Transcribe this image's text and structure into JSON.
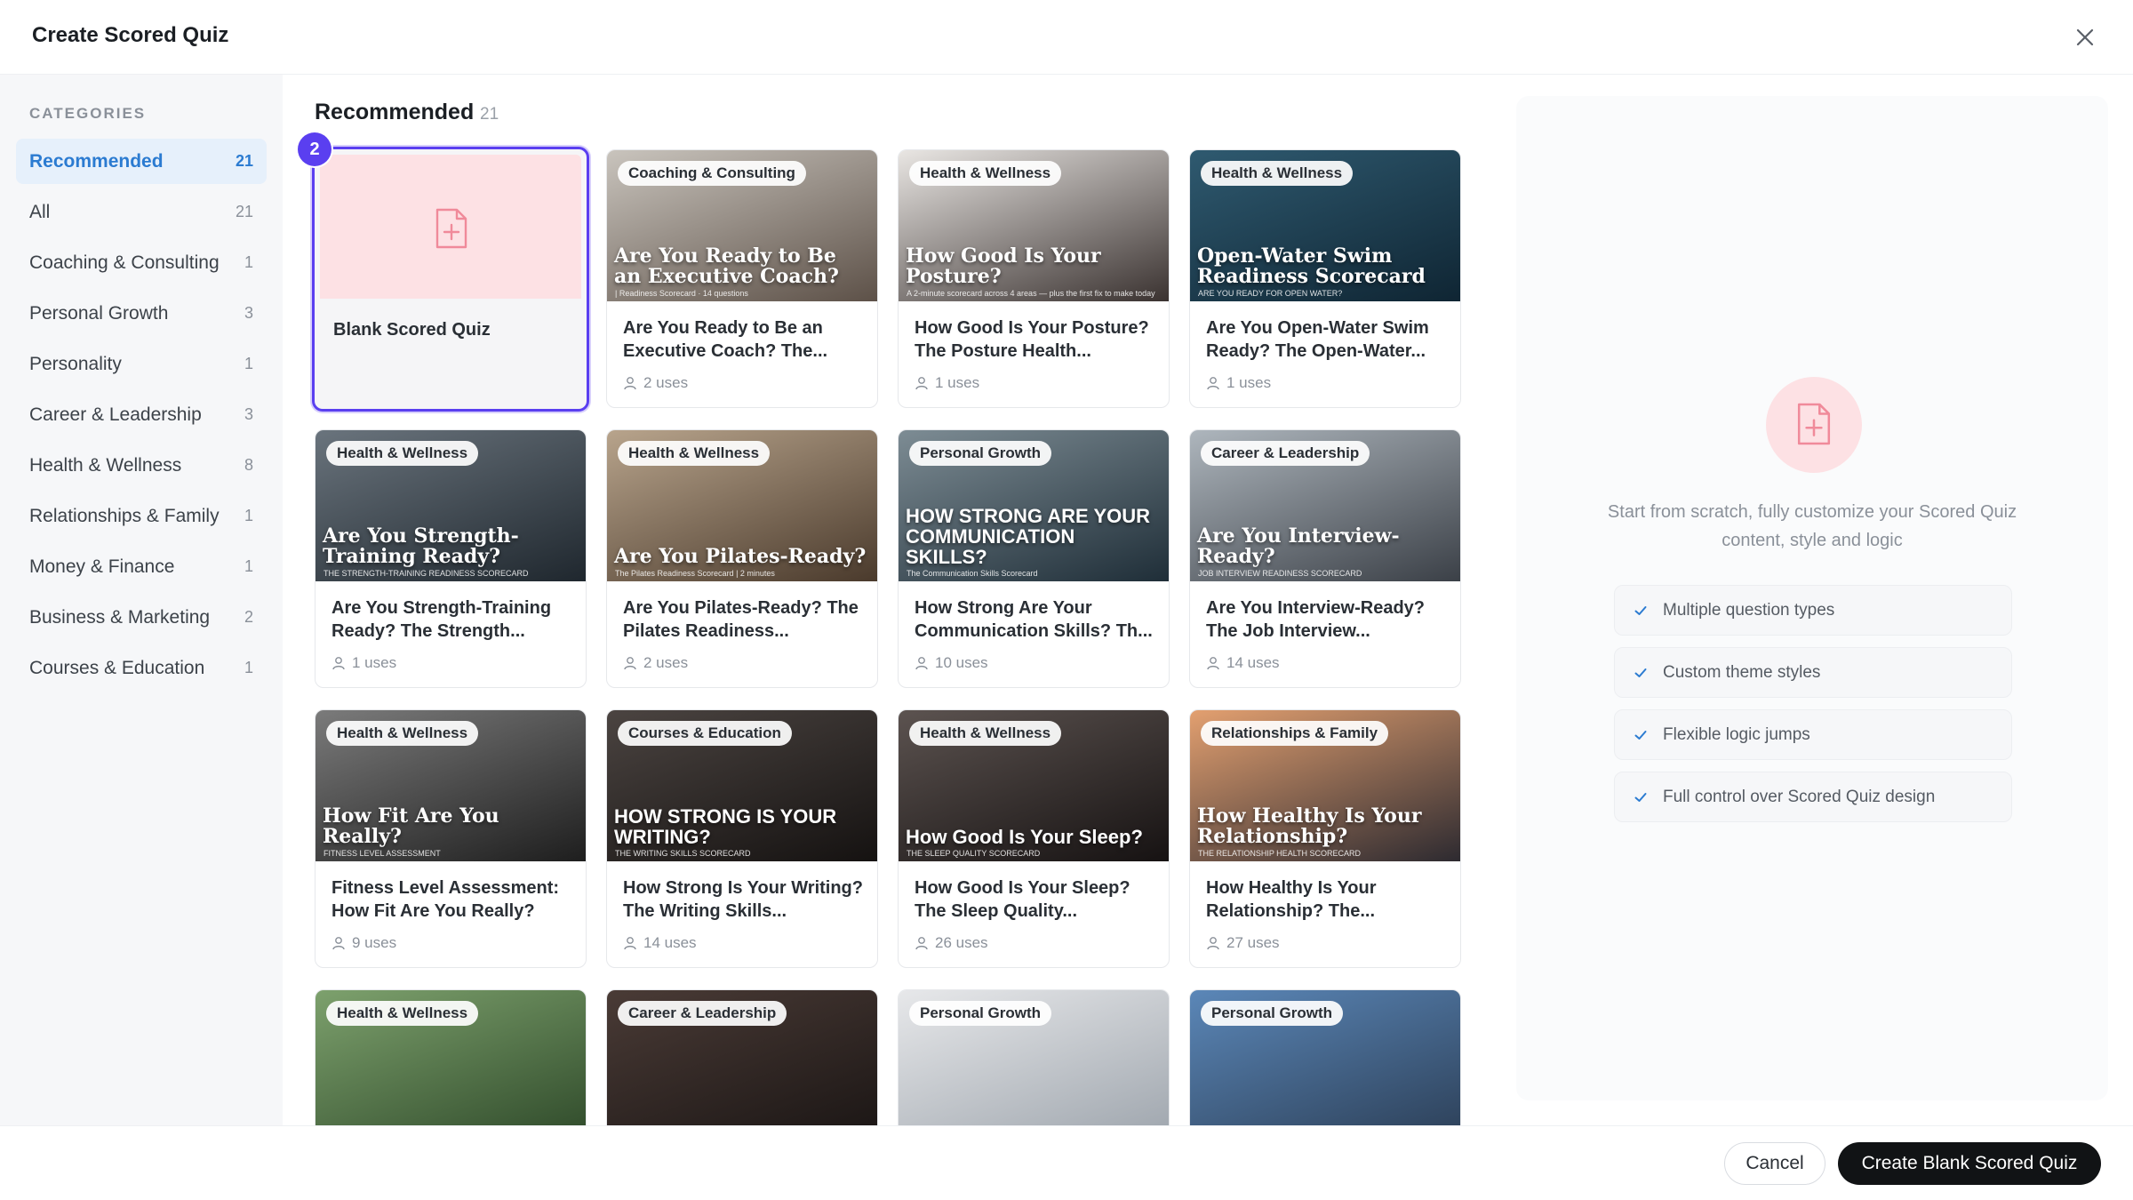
{
  "header": {
    "title": "Create Scored Quiz",
    "close_icon": "close-icon"
  },
  "sidebar": {
    "heading": "CATEGORIES",
    "items": [
      {
        "label": "Recommended",
        "count": "21",
        "active": true
      },
      {
        "label": "All",
        "count": "21"
      },
      {
        "label": "Coaching & Consulting",
        "count": "1"
      },
      {
        "label": "Personal Growth",
        "count": "3"
      },
      {
        "label": "Personality",
        "count": "1"
      },
      {
        "label": "Career & Leadership",
        "count": "3"
      },
      {
        "label": "Health & Wellness",
        "count": "8"
      },
      {
        "label": "Relationships & Family",
        "count": "1"
      },
      {
        "label": "Money & Finance",
        "count": "1"
      },
      {
        "label": "Business & Marketing",
        "count": "2"
      },
      {
        "label": "Courses & Education",
        "count": "1"
      }
    ]
  },
  "main": {
    "title": "Recommended",
    "count": "21",
    "blank": {
      "title": "Blank Scored Quiz",
      "badge": "2"
    },
    "cards": [
      {
        "tag": "Coaching & Consulting",
        "overlay": "Are You Ready to Be an Executive Coach?",
        "overlay_sub": "| Readiness Scorecard · 14 questions",
        "title": "Are You Ready to Be an Executive Coach? The...",
        "uses": "2 uses",
        "c1": "#c9c4bd",
        "c2": "#5d5148"
      },
      {
        "tag": "Health & Wellness",
        "overlay": "How Good Is Your Posture?",
        "overlay_sub": "A 2-minute scorecard across 4 areas — plus the first fix to make today",
        "title": "How Good Is Your Posture? The Posture Health...",
        "uses": "1 uses",
        "c1": "#e9e6e3",
        "c2": "#3a3230"
      },
      {
        "tag": "Health & Wellness",
        "overlay": "Open-Water Swim Readiness Scorecard",
        "overlay_sub": "ARE YOU READY FOR OPEN WATER?",
        "title": "Are You Open-Water Swim Ready? The Open-Water...",
        "uses": "1 uses",
        "c1": "#2f5a70",
        "c2": "#0f2533"
      },
      {
        "tag": "Health & Wellness",
        "overlay": "Are You Strength-Training Ready?",
        "overlay_sub": "THE STRENGTH-TRAINING READINESS SCORECARD",
        "title": "Are You Strength-Training Ready? The Strength...",
        "uses": "1 uses",
        "c1": "#6a747d",
        "c2": "#1f272e"
      },
      {
        "tag": "Health & Wellness",
        "overlay": "Are You Pilates-Ready?",
        "overlay_sub": "The Pilates Readiness Scorecard | 2 minutes",
        "title": "Are You Pilates-Ready? The Pilates Readiness...",
        "uses": "2 uses",
        "c1": "#b8a48c",
        "c2": "#4a3a2c"
      },
      {
        "tag": "Personal Growth",
        "overlay": "HOW STRONG ARE YOUR COMMUNICATION SKILLS?",
        "overlay_sub": "The Communication Skills Scorecard",
        "title": "How Strong Are Your Communication Skills? Th...",
        "uses": "10 uses",
        "c1": "#7d8c94",
        "c2": "#1f2e38"
      },
      {
        "tag": "Career & Leadership",
        "overlay": "Are You Interview-Ready?",
        "overlay_sub": "JOB INTERVIEW READINESS SCORECARD",
        "title": "Are You Interview-Ready? The Job Interview...",
        "uses": "14 uses",
        "c1": "#aeb6bd",
        "c2": "#3b4047"
      },
      {
        "tag": "Health & Wellness",
        "overlay": "How Fit Are You Really?",
        "overlay_sub": "FITNESS LEVEL ASSESSMENT",
        "title": "Fitness Level Assessment: How Fit Are You Really?",
        "uses": "9 uses",
        "c1": "#7b7b7b",
        "c2": "#1e1e1e"
      },
      {
        "tag": "Courses & Education",
        "overlay": "HOW STRONG IS YOUR WRITING?",
        "overlay_sub": "THE WRITING SKILLS SCORECARD",
        "title": "How Strong Is Your Writing? The Writing Skills...",
        "uses": "14 uses",
        "c1": "#4b4441",
        "c2": "#151211"
      },
      {
        "tag": "Health & Wellness",
        "overlay": "How Good Is Your Sleep?",
        "overlay_sub": "THE SLEEP QUALITY SCORECARD",
        "title": "How Good Is Your Sleep? The Sleep Quality...",
        "uses": "26 uses",
        "c1": "#5c5350",
        "c2": "#161212"
      },
      {
        "tag": "Relationships & Family",
        "overlay": "How Healthy Is Your Relationship?",
        "overlay_sub": "THE RELATIONSHIP HEALTH SCORECARD",
        "title": "How Healthy Is Your Relationship? The...",
        "uses": "27 uses",
        "c1": "#e3a070",
        "c2": "#2d2a30"
      },
      {
        "tag": "Health & Wellness",
        "overlay": "",
        "overlay_sub": "",
        "title": "",
        "uses": "",
        "c1": "#7da16d",
        "c2": "#2f4a2a"
      },
      {
        "tag": "Career & Leadership",
        "overlay": "",
        "overlay_sub": "",
        "title": "",
        "uses": "",
        "c1": "#4a3b36",
        "c2": "#1a1514"
      },
      {
        "tag": "Personal Growth",
        "overlay": "",
        "overlay_sub": "",
        "title": "",
        "uses": "",
        "c1": "#e7e8ea",
        "c2": "#9ea5ad"
      },
      {
        "tag": "Personal Growth",
        "overlay": "",
        "overlay_sub": "",
        "title": "",
        "uses": "",
        "c1": "#5b87b8",
        "c2": "#2c3f57"
      }
    ]
  },
  "preview": {
    "icon": "file-plus-icon",
    "description": "Start from scratch, fully customize your Scored Quiz content, style and logic",
    "features": [
      "Multiple question types",
      "Custom theme styles",
      "Flexible logic jumps",
      "Full control over Scored Quiz design"
    ]
  },
  "footer": {
    "cancel_label": "Cancel",
    "create_label": "Create Blank Scored Quiz"
  }
}
